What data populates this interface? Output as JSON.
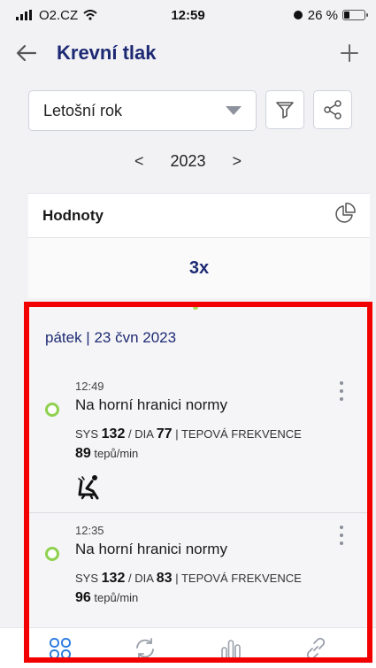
{
  "status_bar": {
    "carrier": "O2.CZ",
    "time": "12:59",
    "battery": "26 %",
    "battery_level": 0.26,
    "icons": [
      "signal-icon",
      "wifi-icon",
      "alarm-icon",
      "battery-icon"
    ]
  },
  "header": {
    "title": "Krevní tlak",
    "back_icon": "back-arrow-icon",
    "add_icon": "plus-icon"
  },
  "filter": {
    "selected": "Letošní rok",
    "filter_icon": "filter-icon",
    "share_icon": "share-icon"
  },
  "year_nav": {
    "prev": "<",
    "year": "2023",
    "next": ">"
  },
  "values": {
    "title": "Hodnoty",
    "count": "3x",
    "chart_icon": "pie-chart-icon"
  },
  "day": {
    "label": "pátek | 23 čvn 2023"
  },
  "entries": [
    {
      "time": "12:49",
      "status": "Na horní hranici normy",
      "sys_label": "SYS",
      "sys": "132",
      "dia_label": "/ DIA",
      "dia": "77",
      "pulse_label": "| TEPOVÁ FREKVENCE",
      "pulse": "89",
      "pulse_unit": "tepů/min",
      "posture_icon": "reclining-chair-icon"
    },
    {
      "time": "12:35",
      "status": "Na horní hranici normy",
      "sys_label": "SYS",
      "sys": "132",
      "dia_label": "/ DIA",
      "dia": "83",
      "pulse_label": "| TEPOVÁ FREKVENCE",
      "pulse": "96",
      "pulse_unit": "tepů/min"
    }
  ],
  "colors": {
    "accent": "#1d2a73",
    "status_ok": "#8fd14f",
    "highlight": "#f20000",
    "tab_active": "#2f7de1",
    "tab_inactive": "#9aa0aa"
  },
  "tabbar": {
    "tabs": [
      "grid-icon",
      "sync-icon",
      "bar-chart-icon",
      "link-icon"
    ],
    "active": 0
  }
}
